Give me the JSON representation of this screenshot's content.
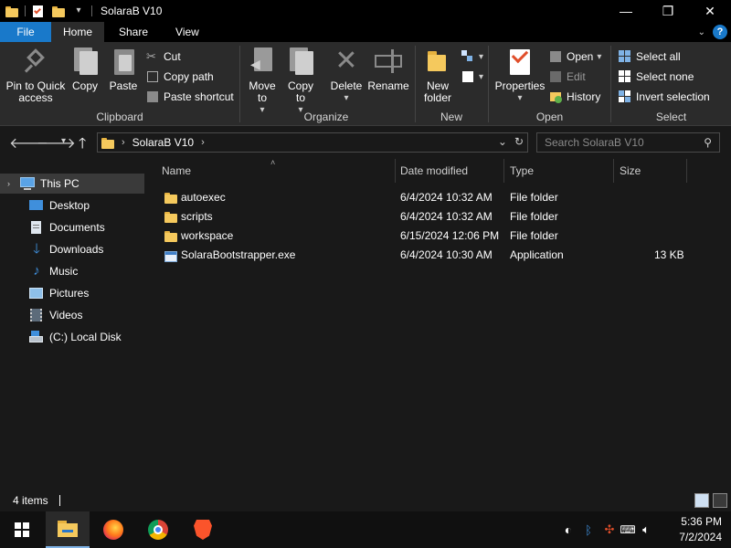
{
  "window": {
    "title": "SolaraB V10",
    "min": "—",
    "max": "❐",
    "close": "✕"
  },
  "tabs": {
    "file": "File",
    "home": "Home",
    "share": "Share",
    "view": "View",
    "help": "?",
    "collapse": "⌄"
  },
  "ribbon": {
    "clipboard": {
      "label": "Clipboard",
      "pin": "Pin to Quick access",
      "copy": "Copy",
      "paste": "Paste",
      "cut": "Cut",
      "copy_path": "Copy path",
      "paste_shortcut": "Paste shortcut"
    },
    "organize": {
      "label": "Organize",
      "move_to": "Move to",
      "copy_to": "Copy to",
      "delete": "Delete",
      "rename": "Rename"
    },
    "new": {
      "label": "New",
      "new_folder": "New folder"
    },
    "open": {
      "label": "Open",
      "properties": "Properties",
      "open": "Open",
      "edit": "Edit",
      "history": "History"
    },
    "select": {
      "label": "Select",
      "select_all": "Select all",
      "select_none": "Select none",
      "invert": "Invert selection"
    }
  },
  "address": {
    "path": "SolaraB V10",
    "search_placeholder": "Search SolaraB V10"
  },
  "nav": {
    "this_pc": "This PC",
    "desktop": "Desktop",
    "documents": "Documents",
    "downloads": "Downloads",
    "music": "Music",
    "pictures": "Pictures",
    "videos": "Videos",
    "local_disk": "(C:) Local Disk"
  },
  "columns": {
    "name": "Name",
    "date": "Date modified",
    "type": "Type",
    "size": "Size"
  },
  "files": [
    {
      "name": "autoexec",
      "date": "6/4/2024 10:32 AM",
      "type": "File folder",
      "size": ""
    },
    {
      "name": "scripts",
      "date": "6/4/2024 10:32 AM",
      "type": "File folder",
      "size": ""
    },
    {
      "name": "workspace",
      "date": "6/15/2024 12:06 PM",
      "type": "File folder",
      "size": ""
    },
    {
      "name": "SolaraBootstrapper.exe",
      "date": "6/4/2024 10:30 AM",
      "type": "Application",
      "size": "13 KB"
    }
  ],
  "status": {
    "items": "4 items"
  },
  "taskbar": {
    "time": "5:36 PM",
    "date": "7/2/2024"
  },
  "colors": {
    "accent": "#1979ca",
    "folder": "#f5c95d"
  }
}
